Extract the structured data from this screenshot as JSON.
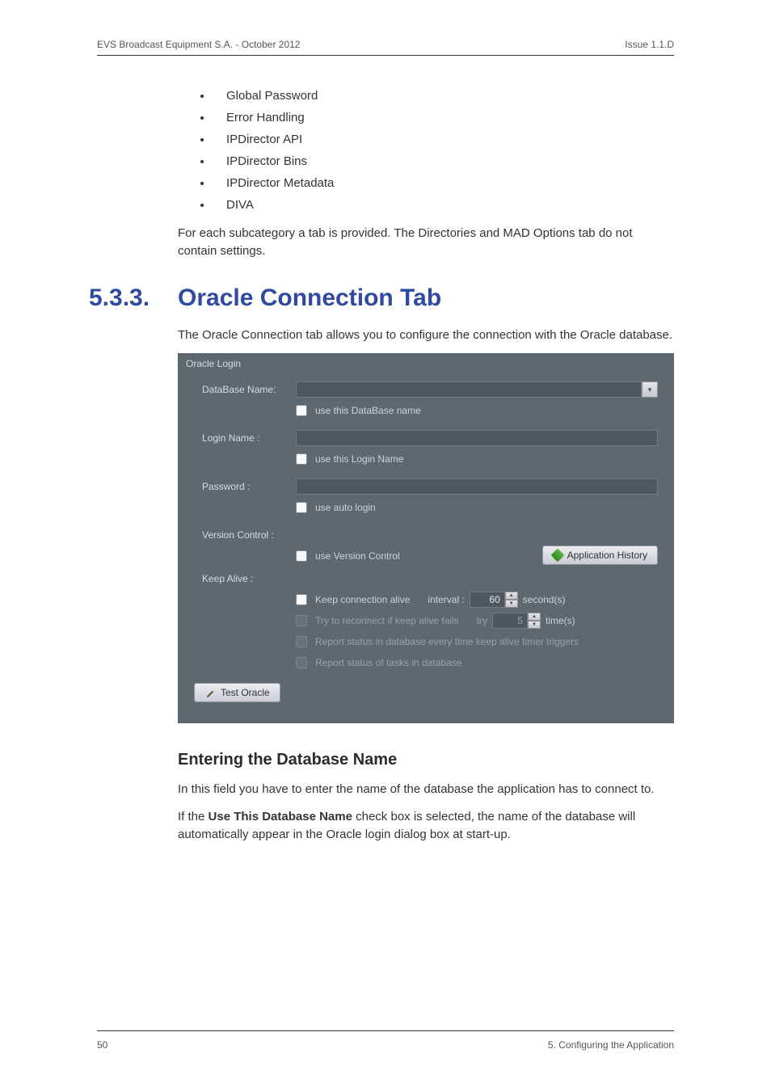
{
  "header": {
    "left": "EVS Broadcast Equipment S.A.  - October 2012",
    "right": "Issue 1.1.D"
  },
  "top_bullets": [
    "Global Password",
    "Error Handling",
    "IPDirector API",
    "IPDirector Bins",
    "IPDirector Metadata",
    "DIVA"
  ],
  "intro_para": "For each subcategory a tab is provided. The Directories and MAD Options tab do not contain settings.",
  "section": {
    "number": "5.3.3.",
    "title": "Oracle Connection Tab"
  },
  "section_intro": "The Oracle Connection tab allows you to configure the connection with the Oracle database.",
  "panel": {
    "title": "Oracle Login",
    "database_label": "DataBase Name:",
    "cb_use_database": "use this DataBase name",
    "login_label": "Login Name :",
    "cb_use_login": "use this Login Name",
    "password_label": "Password :",
    "cb_auto_login": "use auto login",
    "version_label": "Version Control :",
    "cb_version_control": "use Version Control",
    "app_history_btn": "Application History",
    "keepalive_label": "Keep Alive :",
    "cb_keepalive": "Keep connection alive",
    "interval_label": "interval :",
    "interval_value": "60",
    "interval_unit": "second(s)",
    "cb_try_reconnect": "Try to reconnect if keep alive fails",
    "try_label": "try",
    "try_value": "5",
    "try_unit": "time(s)",
    "cb_report_status_trigger": "Report status in database every time keep alive timer triggers",
    "cb_report_status_tasks": "Report status of tasks in database",
    "test_btn": "Test Oracle"
  },
  "subsection_title": "Entering the Database Name",
  "sub_para1": "In this field you have to enter the name of the database the application has to connect to.",
  "sub_para2_prefix": "If the ",
  "sub_para2_bold": "Use This Database Name",
  "sub_para2_suffix": " check box is selected, the name of the database will automatically appear in the Oracle login dialog box at start-up.",
  "footer": {
    "left": "50",
    "right": "5. Configuring the Application"
  }
}
